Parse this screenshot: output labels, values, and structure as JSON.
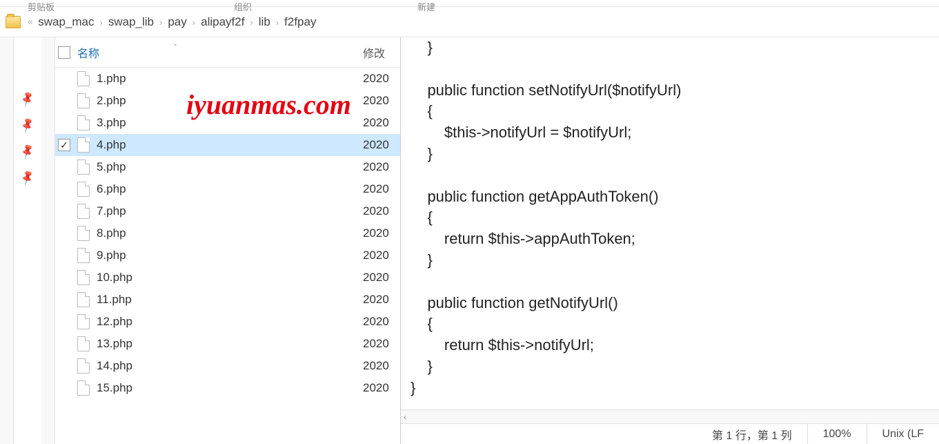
{
  "topStrip": {
    "left": "剪贴板",
    "mid": "组织",
    "right": "新建"
  },
  "breadcrumb": {
    "prefix": "«",
    "sep": "›",
    "items": [
      "swap_mac",
      "swap_lib",
      "pay",
      "alipayf2f",
      "lib",
      "f2fpay"
    ]
  },
  "fileList": {
    "header": {
      "name": "名称",
      "sorter": "ˆ",
      "date": "修改"
    },
    "rows": [
      {
        "name": "1.php",
        "date": "2020",
        "checked": false,
        "selected": false,
        "showCheckbox": false
      },
      {
        "name": "2.php",
        "date": "2020",
        "checked": false,
        "selected": false,
        "showCheckbox": false
      },
      {
        "name": "3.php",
        "date": "2020",
        "checked": false,
        "selected": false,
        "showCheckbox": false
      },
      {
        "name": "4.php",
        "date": "2020",
        "checked": true,
        "selected": true,
        "showCheckbox": true
      },
      {
        "name": "5.php",
        "date": "2020",
        "checked": false,
        "selected": false,
        "showCheckbox": false
      },
      {
        "name": "6.php",
        "date": "2020",
        "checked": false,
        "selected": false,
        "showCheckbox": false
      },
      {
        "name": "7.php",
        "date": "2020",
        "checked": false,
        "selected": false,
        "showCheckbox": false
      },
      {
        "name": "8.php",
        "date": "2020",
        "checked": false,
        "selected": false,
        "showCheckbox": false
      },
      {
        "name": "9.php",
        "date": "2020",
        "checked": false,
        "selected": false,
        "showCheckbox": false
      },
      {
        "name": "10.php",
        "date": "2020",
        "checked": false,
        "selected": false,
        "showCheckbox": false
      },
      {
        "name": "11.php",
        "date": "2020",
        "checked": false,
        "selected": false,
        "showCheckbox": false
      },
      {
        "name": "12.php",
        "date": "2020",
        "checked": false,
        "selected": false,
        "showCheckbox": false
      },
      {
        "name": "13.php",
        "date": "2020",
        "checked": false,
        "selected": false,
        "showCheckbox": false
      },
      {
        "name": "14.php",
        "date": "2020",
        "checked": false,
        "selected": false,
        "showCheckbox": false
      },
      {
        "name": "15.php",
        "date": "2020",
        "checked": false,
        "selected": false,
        "showCheckbox": false
      }
    ]
  },
  "watermark": "iyuanmas.com",
  "pins": [
    "📌",
    "📌",
    "📌",
    "📌"
  ],
  "editor": {
    "code": "    }\n\n    public function setNotifyUrl($notifyUrl)\n    {\n        $this->notifyUrl = $notifyUrl;\n    }\n\n    public function getAppAuthToken()\n    {\n        return $this->appAuthToken;\n    }\n\n    public function getNotifyUrl()\n    {\n        return $this->notifyUrl;\n    }\n}",
    "scrollChevron": "‹",
    "status": {
      "pos": "第 1 行，第 1 列",
      "zoom": "100%",
      "encoding": "Unix (LF"
    }
  }
}
